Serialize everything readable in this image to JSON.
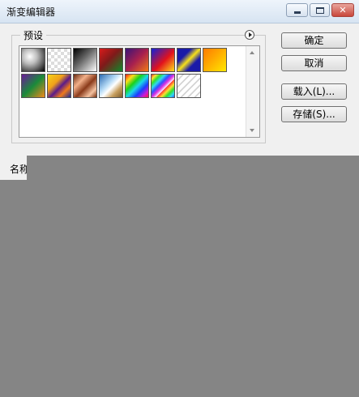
{
  "window": {
    "title": "渐变编辑器"
  },
  "presets": {
    "label": "预设",
    "swatches": [
      {
        "name": "black-white-radial",
        "bg": "radial-gradient(circle at 35% 35%, #ffffff 0%, #bdbdbd 35%, #000000 100%)"
      },
      {
        "name": "transparent-checker",
        "bg": "repeating-conic-gradient(#dcdcdc 0% 25%, #ffffff 0% 50%) 0 0 / 8px 8px"
      },
      {
        "name": "black-white-linear",
        "bg": "linear-gradient(135deg, #000000 0%, #6a6a6a 45%, #ffffff 100%)"
      },
      {
        "name": "red-green",
        "bg": "linear-gradient(135deg, #d81b1b 0%, #7f1a1a 45%, #0e8a2a 100%)"
      },
      {
        "name": "violet-orange",
        "bg": "linear-gradient(135deg, #3a1478 0%, #a8204e 50%, #f07a16 100%)"
      },
      {
        "name": "blue-red-yellow",
        "bg": "linear-gradient(135deg, #1022d8 0%, #e2121c 55%, #ffe21a 100%)"
      },
      {
        "name": "blue-yellow-blue",
        "bg": "linear-gradient(135deg, #1a1aa8 0%, #1a1aa8 30%, #f7e21a 50%, #1a1aa8 70%, #1a1aa8 100%)"
      },
      {
        "name": "orange-yellow",
        "bg": "linear-gradient(135deg, #ff7a00 0%, #ffb000 50%, #ffe800 100%)"
      },
      {
        "name": "violet-green-orange",
        "bg": "linear-gradient(135deg, #6a1a9a 0%, #1a8a3a 50%, #f08a1a 100%)"
      },
      {
        "name": "yellow-violet-orange",
        "bg": "linear-gradient(135deg, #f6d21a 0%, #f0a01a 35%, #5a1a8a 55%, #f07a1a 75%, #1a2a9a 100%)"
      },
      {
        "name": "copper",
        "bg": "linear-gradient(135deg, #6a2a10 0%, #f2b08a 30%, #8a3a1a 55%, #f4c2a0 80%, #7a3010 100%)"
      },
      {
        "name": "chrome",
        "bg": "linear-gradient(135deg, #2a6ab2 0%, #b8dcf6 40%, #ffffff 55%, #c8a060 75%, #7a5a2a 100%)"
      },
      {
        "name": "spectrum",
        "bg": "linear-gradient(135deg, #ff1a1a 0%, #ffdc1a 18%, #1ad21a 36%, #1ad8e6 52%, #1a3cff 70%, #c81ad8 86%, #ff1a3c 100%)"
      },
      {
        "name": "transparent-rainbow",
        "bg": "repeating-linear-gradient(135deg, #ff3030 0px, #ffe030 4px, #30e030 8px, #30d8f0 12px, #3050ff 16px, #e030e0 20px, #ffffff 24px)"
      },
      {
        "name": "transparent-stripes",
        "bg": "repeating-linear-gradient(135deg, #ffffff 0px, #ffffff 4px, #d4d4d4 4px, #d4d4d4 6px)"
      }
    ]
  },
  "buttons": {
    "ok": "确定",
    "cancel": "取消",
    "load": "载入(L)...",
    "save": "存储(S)..."
  },
  "fields": {
    "name_label": "名称"
  }
}
